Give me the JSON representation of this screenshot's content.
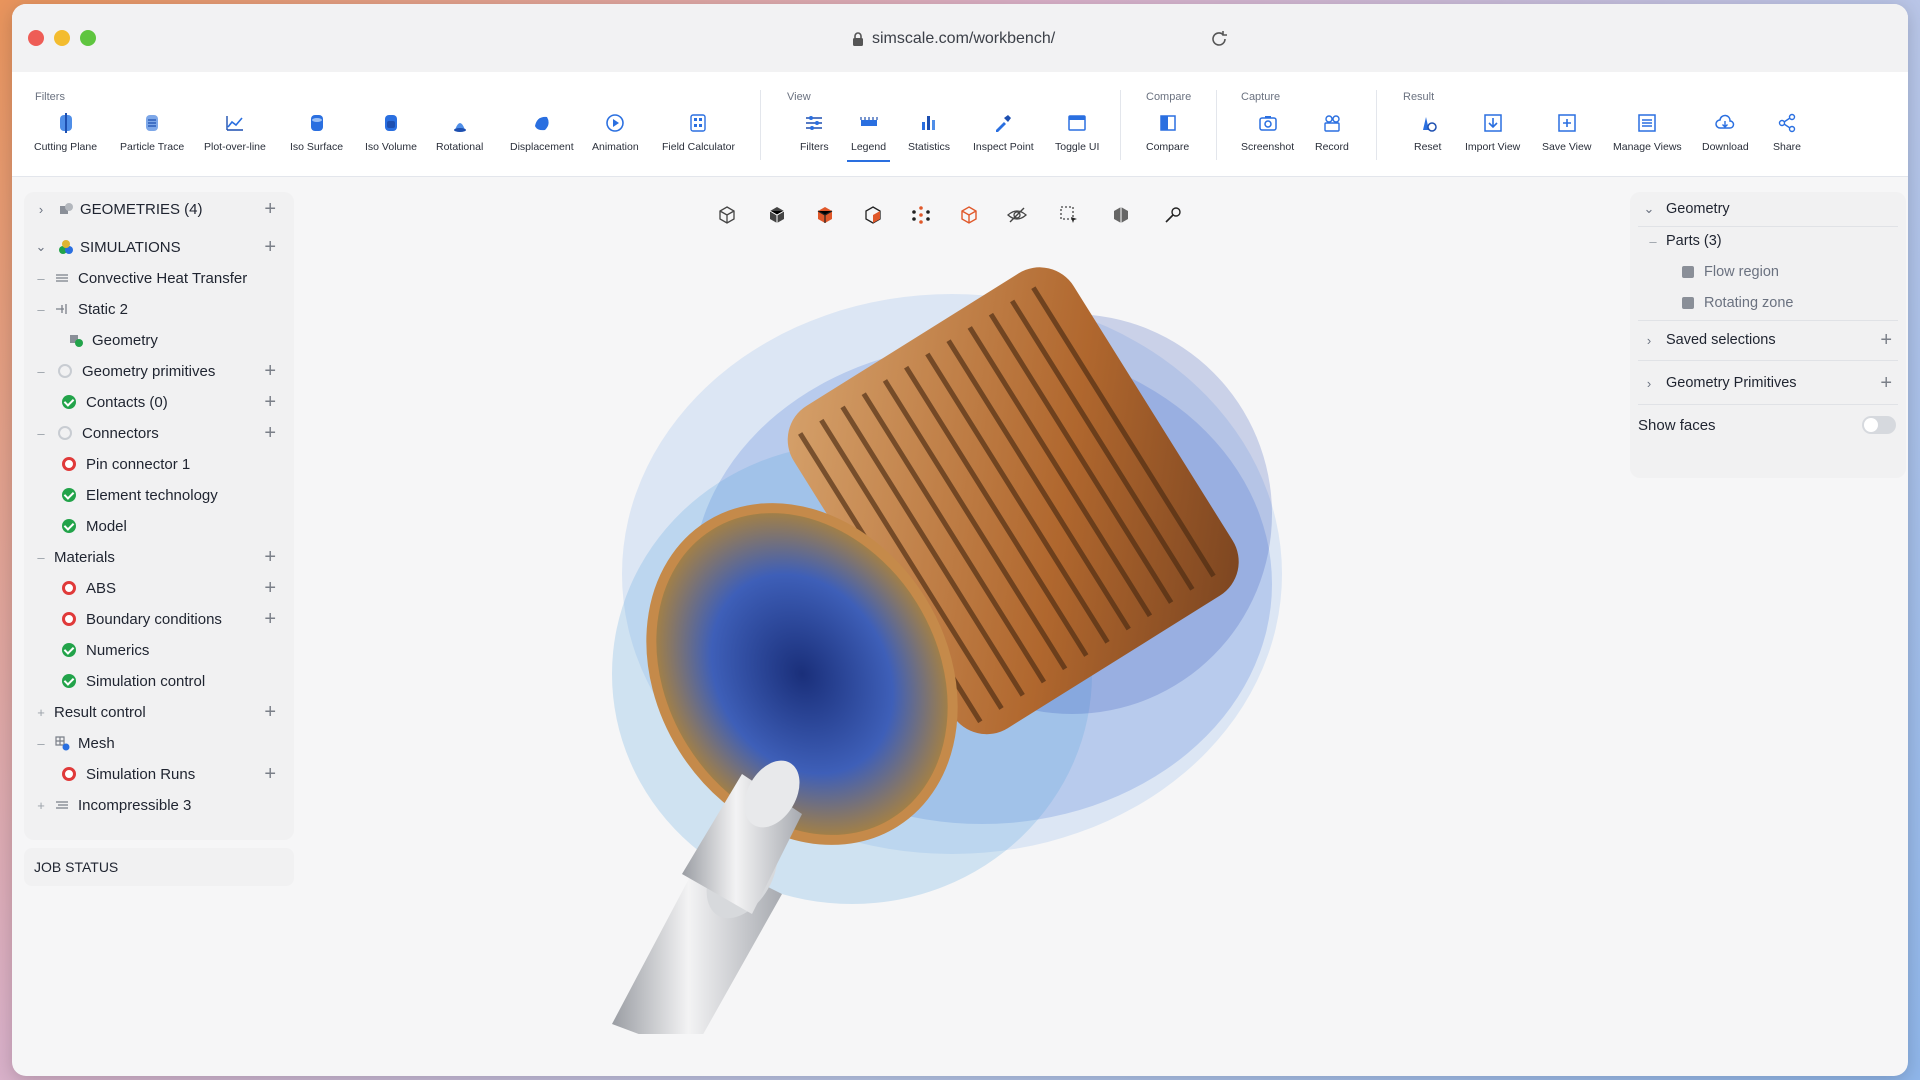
{
  "browser": {
    "url": "simscale.com/workbench/"
  },
  "toolbar": {
    "groups": {
      "filters": "Filters",
      "view": "View",
      "compare": "Compare",
      "capture": "Capture",
      "result": "Result"
    },
    "tools": {
      "cutting_plane": "Cutting Plane",
      "particle_trace": "Particle Trace",
      "plot_over_line": "Plot-over-line",
      "iso_surface": "Iso Surface",
      "iso_volume": "Iso Volume",
      "rotational": "Rotational",
      "displacement": "Displacement",
      "animation": "Animation",
      "field_calculator": "Field Calculator",
      "filters": "Filters",
      "legend": "Legend",
      "statistics": "Statistics",
      "inspect_point": "Inspect Point",
      "toggle_ui": "Toggle UI",
      "compare": "Compare",
      "screenshot": "Screenshot",
      "record": "Record",
      "reset": "Reset",
      "import_view": "Import View",
      "save_view": "Save View",
      "manage_views": "Manage Views",
      "download": "Download",
      "share": "Share"
    },
    "active_tool": "Legend"
  },
  "tree": {
    "geometries": "GEOMETRIES (4)",
    "simulations": "SIMULATIONS",
    "items": [
      {
        "label": "Convective Heat Transfer",
        "status": "none"
      },
      {
        "label": "Static 2",
        "status": "none"
      },
      {
        "label": "Geometry",
        "status": "ok"
      },
      {
        "label": "Geometry primitives",
        "status": "idle"
      },
      {
        "label": "Contacts (0)",
        "status": "ok"
      },
      {
        "label": "Connectors",
        "status": "idle"
      },
      {
        "label": "Pin connector 1",
        "status": "error"
      },
      {
        "label": "Element technology",
        "status": "ok"
      },
      {
        "label": "Model",
        "status": "ok"
      },
      {
        "label": "Materials",
        "status": "none"
      },
      {
        "label": "ABS",
        "status": "error"
      },
      {
        "label": "Boundary conditions",
        "status": "error"
      },
      {
        "label": "Numerics",
        "status": "ok"
      },
      {
        "label": "Simulation control",
        "status": "ok"
      },
      {
        "label": "Result control",
        "status": "none"
      },
      {
        "label": "Mesh",
        "status": "none"
      },
      {
        "label": "Simulation Runs",
        "status": "error"
      },
      {
        "label": "Incompressible 3",
        "status": "none"
      }
    ]
  },
  "job_status": "JOB STATUS",
  "right_panel": {
    "geometry": "Geometry",
    "parts": "Parts (3)",
    "flow_region": "Flow region",
    "rotating_zone": "Rotating zone",
    "saved_selections": "Saved selections",
    "geometry_primitives": "Geometry Primitives",
    "show_faces": "Show faces",
    "show_faces_enabled": false
  },
  "colors": {
    "accent": "#2a6fe0",
    "ok": "#22a34a",
    "error": "#e03a3a",
    "copper": "#c0783a",
    "flow_blue": "#3a6fd8"
  }
}
